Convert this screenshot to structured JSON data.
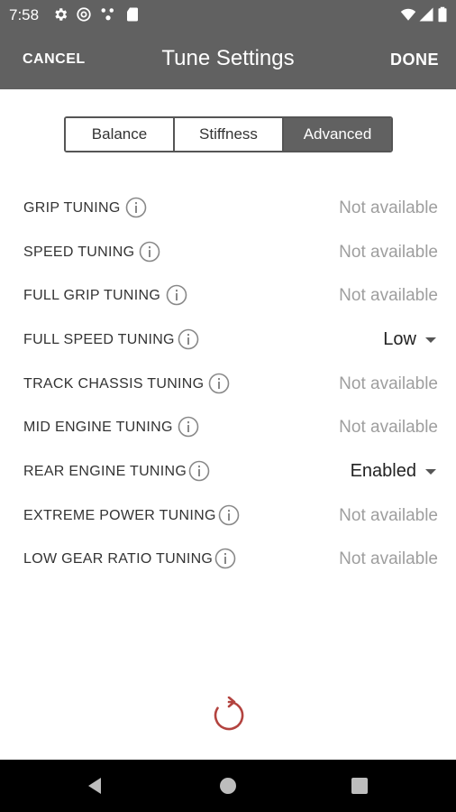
{
  "status_bar": {
    "time": "7:58",
    "left_icons": [
      "settings-icon",
      "at-sign-icon",
      "network-dots-icon",
      "sd-card-icon"
    ],
    "right_icons": [
      "wifi-icon",
      "signal-icon",
      "battery-icon"
    ]
  },
  "app_bar": {
    "cancel_label": "CANCEL",
    "title": "Tune Settings",
    "done_label": "DONE"
  },
  "tabs": [
    {
      "label": "Balance",
      "active": false
    },
    {
      "label": "Stiffness",
      "active": false
    },
    {
      "label": "Advanced",
      "active": true
    }
  ],
  "settings": [
    {
      "label": "GRIP TUNING",
      "value": "Not available",
      "available": false
    },
    {
      "label": "SPEED TUNING",
      "value": "Not available",
      "available": false
    },
    {
      "label": "FULL GRIP TUNING",
      "value": "Not available",
      "available": false
    },
    {
      "label": "FULL SPEED TUNING",
      "value": "Low",
      "available": true
    },
    {
      "label": "TRACK CHASSIS TUNING",
      "value": "Not available",
      "available": false
    },
    {
      "label": "MID ENGINE TUNING",
      "value": "Not available",
      "available": false
    },
    {
      "label": "REAR ENGINE TUNING",
      "value": "Enabled",
      "available": true
    },
    {
      "label": "EXTREME POWER TUNING",
      "value": "Not available",
      "available": false
    },
    {
      "label": "LOW GEAR RATIO TUNING",
      "value": "Not available",
      "available": false
    }
  ],
  "colors": {
    "bar": "#616161",
    "reset_icon": "#b3433f",
    "disabled_text": "#9e9e9e"
  },
  "nav_bar": {
    "buttons": [
      "back-icon",
      "home-icon",
      "recents-icon"
    ]
  }
}
